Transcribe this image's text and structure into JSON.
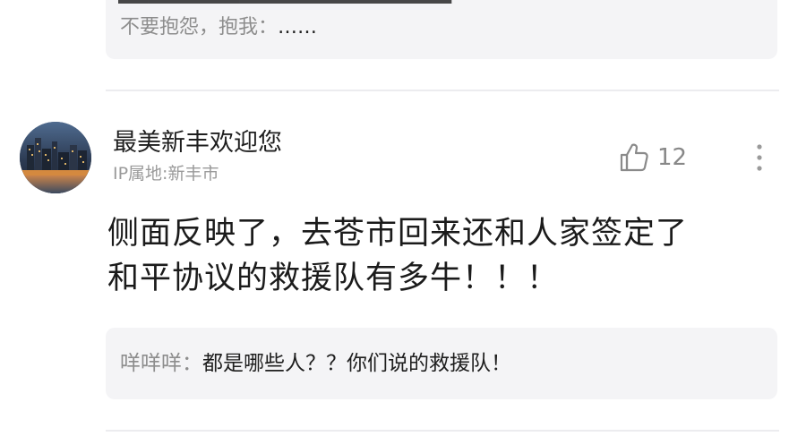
{
  "previous_comment": {
    "reply": {
      "author": "不要抱怨，抱我：",
      "text": "……"
    }
  },
  "comment": {
    "username": "最美新丰欢迎您",
    "ip_location": "IP属地:新丰市",
    "likes": "12",
    "body_line1": "侧面反映了，去苍市回来还和人家签定了",
    "body_line2": "和平协议的救援队有多牛！！！",
    "reply": {
      "author": "咩咩咩：",
      "text": "都是哪些人？？你们说的救援队！"
    }
  },
  "icons": {
    "like": "thumbs-up-icon",
    "more": "more-vertical-icon",
    "avatar": "city-night-photo"
  }
}
